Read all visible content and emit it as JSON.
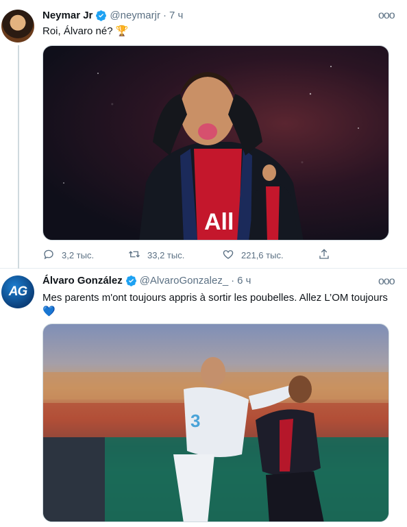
{
  "tweets": [
    {
      "name": "Neymar Jr",
      "handle": "@neymarjr",
      "dot": "·",
      "time": "7 ч",
      "text": "Roi, Álvaro né? 🏆",
      "more": "ooo",
      "actions": {
        "replies": "3,2 тыс.",
        "retweets": "33,2 тыс.",
        "likes": "221,6 тыс."
      }
    },
    {
      "name": "Álvaro González",
      "handle": "@AlvaroGonzalez_",
      "dot": "·",
      "time": "6 ч",
      "text": "Mes parents m'ont toujours appris à sortir les poubelles. Allez L’OM toujours 💙",
      "more": "ooo",
      "avatar_text": "AG"
    }
  ],
  "icons": {
    "verified": "verified-badge-icon",
    "reply": "reply-icon",
    "retweet": "retweet-icon",
    "like": "heart-icon",
    "share": "share-icon"
  },
  "colors": {
    "accent": "#1da1f2",
    "muted": "#5b7083",
    "border": "#e6ecf0"
  }
}
